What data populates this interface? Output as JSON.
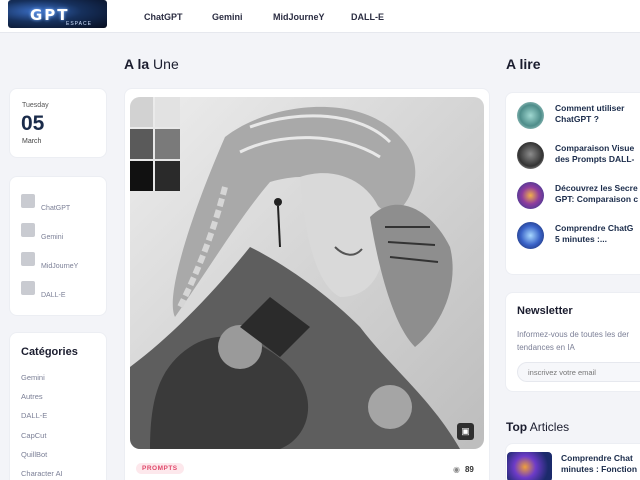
{
  "logo": {
    "text": "GPT",
    "subtext": "ESPACE"
  },
  "nav": {
    "items": [
      "ChatGPT",
      "Gemini",
      "MidJourneY",
      "DALL-E"
    ]
  },
  "date": {
    "weekday": "Tuesday",
    "day": "05",
    "month": "March"
  },
  "sidebar_links": [
    "ChatGPT",
    "Gemini",
    "MidJourneY",
    "DALL-E"
  ],
  "categories": {
    "title": "Catégories",
    "items": [
      "Gemini",
      "Autres",
      "DALL-E",
      "CapCut",
      "QuillBot",
      "Character AI"
    ]
  },
  "headline": {
    "bold": "A la",
    "rest": " Une"
  },
  "featured": {
    "tag": "PROMPTS",
    "views": "89"
  },
  "read_section": {
    "title": "A lire"
  },
  "read_items": [
    {
      "line1": "Comment utiliser",
      "line2": "ChatGPT ?"
    },
    {
      "line1": "Comparaison Visue",
      "line2": "des Prompts DALL-"
    },
    {
      "line1": "Découvrez les Secre",
      "line2": "GPT: Comparaison c"
    },
    {
      "line1": "Comprendre ChatG",
      "line2": "5 minutes :..."
    }
  ],
  "newsletter": {
    "title": "Newsletter",
    "desc_line1": "Informez-vous de toutes les der",
    "desc_line2": "tendances en IA",
    "placeholder": "inscrivez votre email"
  },
  "top_articles": {
    "title_bold": "Top",
    "title_rest": " Articles",
    "item_line1": "Comprendre Chat",
    "item_line2": "minutes : Fonction"
  }
}
